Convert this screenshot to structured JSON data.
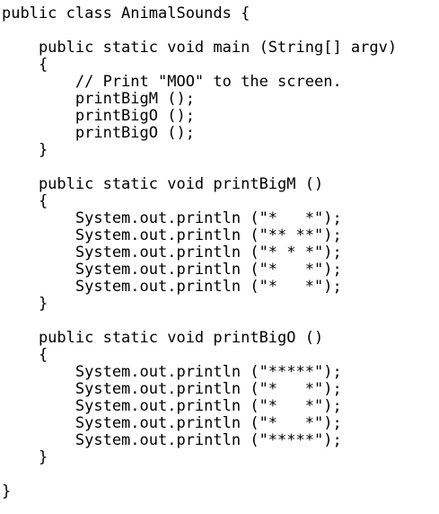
{
  "code": {
    "lines": [
      "public class AnimalSounds {",
      "",
      "    public static void main (String[] argv)",
      "    {",
      "        // Print \"MOO\" to the screen.",
      "        printBigM ();",
      "        printBigO ();",
      "        printBigO ();",
      "    }",
      "",
      "    public static void printBigM ()",
      "    {",
      "        System.out.println (\"*   *\");",
      "        System.out.println (\"** **\");",
      "        System.out.println (\"* * *\");",
      "        System.out.println (\"*   *\");",
      "        System.out.println (\"*   *\");",
      "    }",
      "",
      "    public static void printBigO ()",
      "    {",
      "        System.out.println (\"*****\");",
      "        System.out.println (\"*   *\");",
      "        System.out.println (\"*   *\");",
      "        System.out.println (\"*   *\");",
      "        System.out.println (\"*****\");",
      "    }",
      "",
      "}"
    ]
  }
}
